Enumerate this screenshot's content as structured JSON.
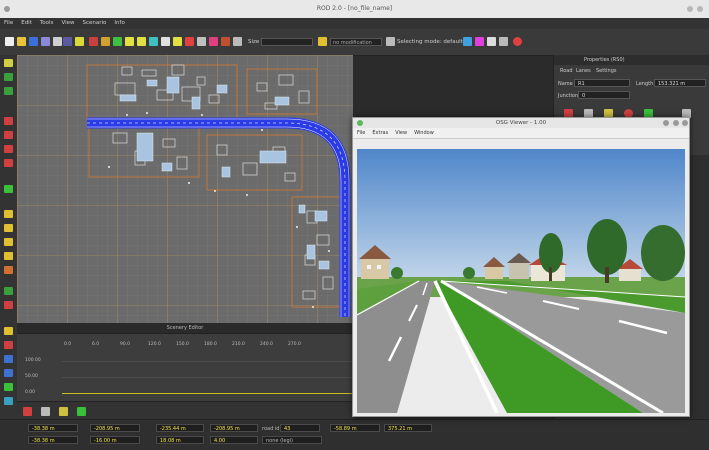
{
  "app": {
    "window_title": "ROD 2.0 - [no_file_name]",
    "menu": [
      "File",
      "Edit",
      "Tools",
      "View",
      "Scenario",
      "Info"
    ]
  },
  "toolbar": {
    "field_label": "Size",
    "field_value": "",
    "mode_value": "no modification",
    "mode_label": "Selecting mode: default"
  },
  "properties": {
    "header": "Properties (RS0)",
    "tabs": [
      "Road",
      "Lanes",
      "Settings"
    ],
    "name_label": "Name",
    "name_value": "R1",
    "length_label": "Length",
    "length_value": "153.321 m",
    "junction_label": "Junction ID",
    "junction_value": "0"
  },
  "scenery": {
    "header": "Scenery Editor",
    "x_ticks": [
      "0.0",
      "6.0",
      "90.0",
      "120.0",
      "150.0",
      "180.0",
      "210.0",
      "240.0",
      "270.0"
    ],
    "y_ticks": [
      "100.00",
      "50.00",
      "0.00"
    ]
  },
  "viewer": {
    "title": "OSG Viewer - 1.00",
    "menu": [
      "File",
      "Extras",
      "View",
      "Window"
    ]
  },
  "status": {
    "r1": [
      {
        "label": "",
        "value": "-38.38 m"
      },
      {
        "label": "",
        "value": "-208.95 m"
      },
      {
        "label": "",
        "value": "-235.44 m"
      },
      {
        "label": "",
        "value": "-208.95 m"
      },
      {
        "label": "road id",
        "value": "43"
      },
      {
        "label": "",
        "value": "-58.89 m"
      },
      {
        "label": "",
        "value": "375.21 m"
      }
    ],
    "r2": [
      {
        "label": "",
        "value": "-38.38 m"
      },
      {
        "label": "",
        "value": "-16.00 m"
      },
      {
        "label": "",
        "value": "18.08 m"
      },
      {
        "label": "",
        "value": "4.00"
      },
      {
        "label": "",
        "value": "none (legi)"
      }
    ]
  },
  "colors": {
    "road": "#2b3ce6",
    "canvas": "#6b6b6b",
    "status_text": "#f2e24a",
    "grass": "#3f9a25",
    "sky": "#6f9fd0"
  }
}
